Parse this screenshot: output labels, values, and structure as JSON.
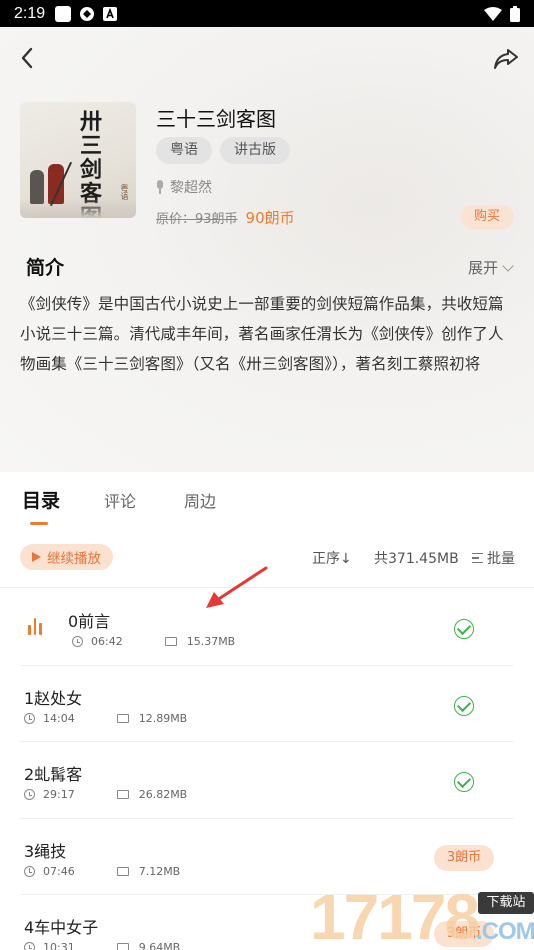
{
  "status_bar": {
    "time": "2:19"
  },
  "book": {
    "title": "三十三剑客图",
    "tags": [
      "粤语",
      "讲古版"
    ],
    "author": "黎超然",
    "original_price": "原价：93朗币",
    "price": "90朗币",
    "buy_label": "购买",
    "cover_title": "卅三剑客图",
    "cover_sub": "粤语"
  },
  "intro": {
    "heading": "简介",
    "expand_label": "展开",
    "text": "《剑侠传》是中国古代小说史上一部重要的剑侠短篇作品集，共收短篇小说三十三篇。清代咸丰年间，著名画家任渭长为《剑侠传》创作了人物画集《三十三剑客图》（又名《卅三剑客图》），著名刻工蔡照初将"
  },
  "tabs": [
    {
      "label": "目录",
      "active": true
    },
    {
      "label": "评论",
      "active": false
    },
    {
      "label": "周边",
      "active": false
    }
  ],
  "toolbar": {
    "continue_label": "继续播放",
    "sort_label": "正序↓",
    "total_label": "共371.45MB",
    "batch_label": "批量"
  },
  "episodes": [
    {
      "title": "0前言",
      "duration": "06:42",
      "size": "15.37MB",
      "status": "downloaded",
      "playing": true
    },
    {
      "title": "1赵处女",
      "duration": "14:04",
      "size": "12.89MB",
      "status": "downloaded",
      "playing": false
    },
    {
      "title": "2虬髯客",
      "duration": "29:17",
      "size": "26.82MB",
      "status": "downloaded",
      "playing": false
    },
    {
      "title": "3绳技",
      "duration": "07:46",
      "size": "7.12MB",
      "status": "price",
      "price": "3朗币",
      "playing": false
    },
    {
      "title": "4车中女子",
      "duration": "10:31",
      "size": "9.64MB",
      "status": "price",
      "price": "3朗币",
      "playing": false
    }
  ],
  "watermark": {
    "digits": "17178",
    "badge": "下载站",
    "domain": ".COM"
  },
  "colors": {
    "accent": "#f07b2e",
    "check": "#3bb54a"
  }
}
